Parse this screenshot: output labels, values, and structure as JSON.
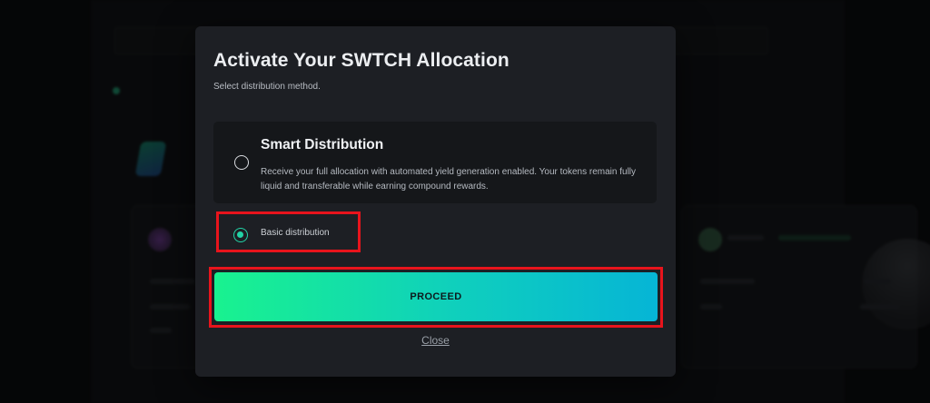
{
  "modal": {
    "title": "Activate Your SWTCH Allocation",
    "subtitle": "Select distribution method.",
    "options": [
      {
        "title": "Smart Distribution",
        "description": "Receive your full allocation with automated yield generation enabled. Your tokens remain fully liquid and transferable while earning compound rewards.",
        "selected": false
      },
      {
        "label": "Basic distribution",
        "selected": true
      }
    ],
    "proceed_label": "PROCEED",
    "close_label": "Close"
  },
  "colors": {
    "modal_bg": "#1d1f24",
    "accent_green": "#22d3a6",
    "highlight_red": "#e8141c",
    "button_gradient_start": "#19f28f",
    "button_gradient_end": "#06b5d6"
  },
  "icons": {
    "background_logo": "swtch-logo-icon"
  }
}
